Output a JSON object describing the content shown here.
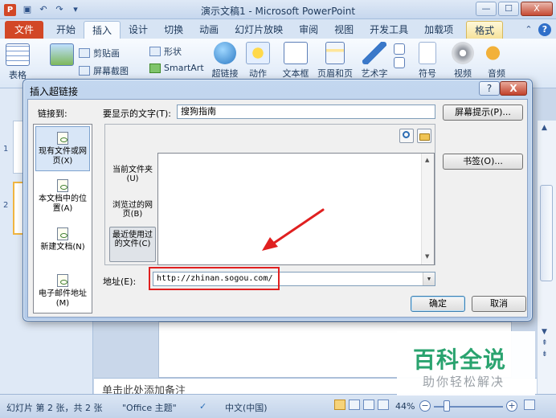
{
  "window": {
    "title": "演示文稿1 - Microsoft PowerPoint",
    "app_icon": "P",
    "controls": {
      "minimize": "—",
      "maximize": "☐",
      "close": "X"
    }
  },
  "quick_access": {
    "save_icon": "▣",
    "undo_icon": "↶",
    "redo_icon": "↷",
    "customize_icon": "▾"
  },
  "ribbon_tabs": {
    "file": "文件",
    "items": [
      "开始",
      "插入",
      "设计",
      "切换",
      "动画",
      "幻灯片放映",
      "审阅",
      "视图",
      "开发工具",
      "加载项",
      "格式"
    ],
    "active_index": 1,
    "collapse_icon": "⌃",
    "help_icon": "?"
  },
  "ribbon": {
    "table_label": "表格",
    "clipart_label": "剪贴画",
    "screenshot_label": "屏幕截图",
    "shapes_label": "形状",
    "smartart_label": "SmartArt",
    "hyperlink_label": "超链接",
    "action_label": "动作",
    "textbox_label": "文本框",
    "header_footer_label": "页眉和页脚",
    "wordart_label": "艺术字",
    "symbol_label": "符号",
    "video_label": "视频",
    "audio_label": "音频",
    "group_label": "表"
  },
  "slides_panel": {
    "slide_numbers": [
      "1",
      "2"
    ],
    "selected_index": 1
  },
  "notes": {
    "placeholder": "单击此处添加备注"
  },
  "statusbar": {
    "slide_info": "幻灯片 第 2 张，共 2 张",
    "theme": "\"Office 主题\"",
    "language": "中文(中国)",
    "zoom": "44%",
    "zoom_out": "−",
    "zoom_in": "+"
  },
  "dialog": {
    "title": "插入超链接",
    "help": "?",
    "close": "X",
    "link_to_label": "链接到:",
    "link_options": [
      {
        "label": "现有文件或网页(X)",
        "selected": true
      },
      {
        "label": "本文档中的位置(A)",
        "selected": false
      },
      {
        "label": "新建文档(N)",
        "selected": false
      },
      {
        "label": "电子邮件地址(M)",
        "selected": false
      }
    ],
    "display_text_label": "要显示的文字(T):",
    "display_text_value": "搜狗指南",
    "screentip_button": "屏幕提示(P)...",
    "bookmark_button": "书签(O)...",
    "scope_options": [
      {
        "label": "当前文件夹(U)",
        "selected": false
      },
      {
        "label": "浏览过的网页(B)",
        "selected": false
      },
      {
        "label": "最近使用过的文件(C)",
        "selected": true
      }
    ],
    "address_label": "地址(E):",
    "address_value": "http://zhinan.sogou.com/",
    "ok_button": "确定",
    "cancel_button": "取消",
    "dropdown_icon": "▼",
    "scroll_up_icon": "▲",
    "scroll_down_icon": "▼"
  },
  "watermark": {
    "main": "百科全说",
    "sub": "助你轻松解决"
  },
  "colors": {
    "file_tab": "#d24726",
    "highlight_box": "#e02020",
    "watermark_green": "#2aa36f"
  }
}
